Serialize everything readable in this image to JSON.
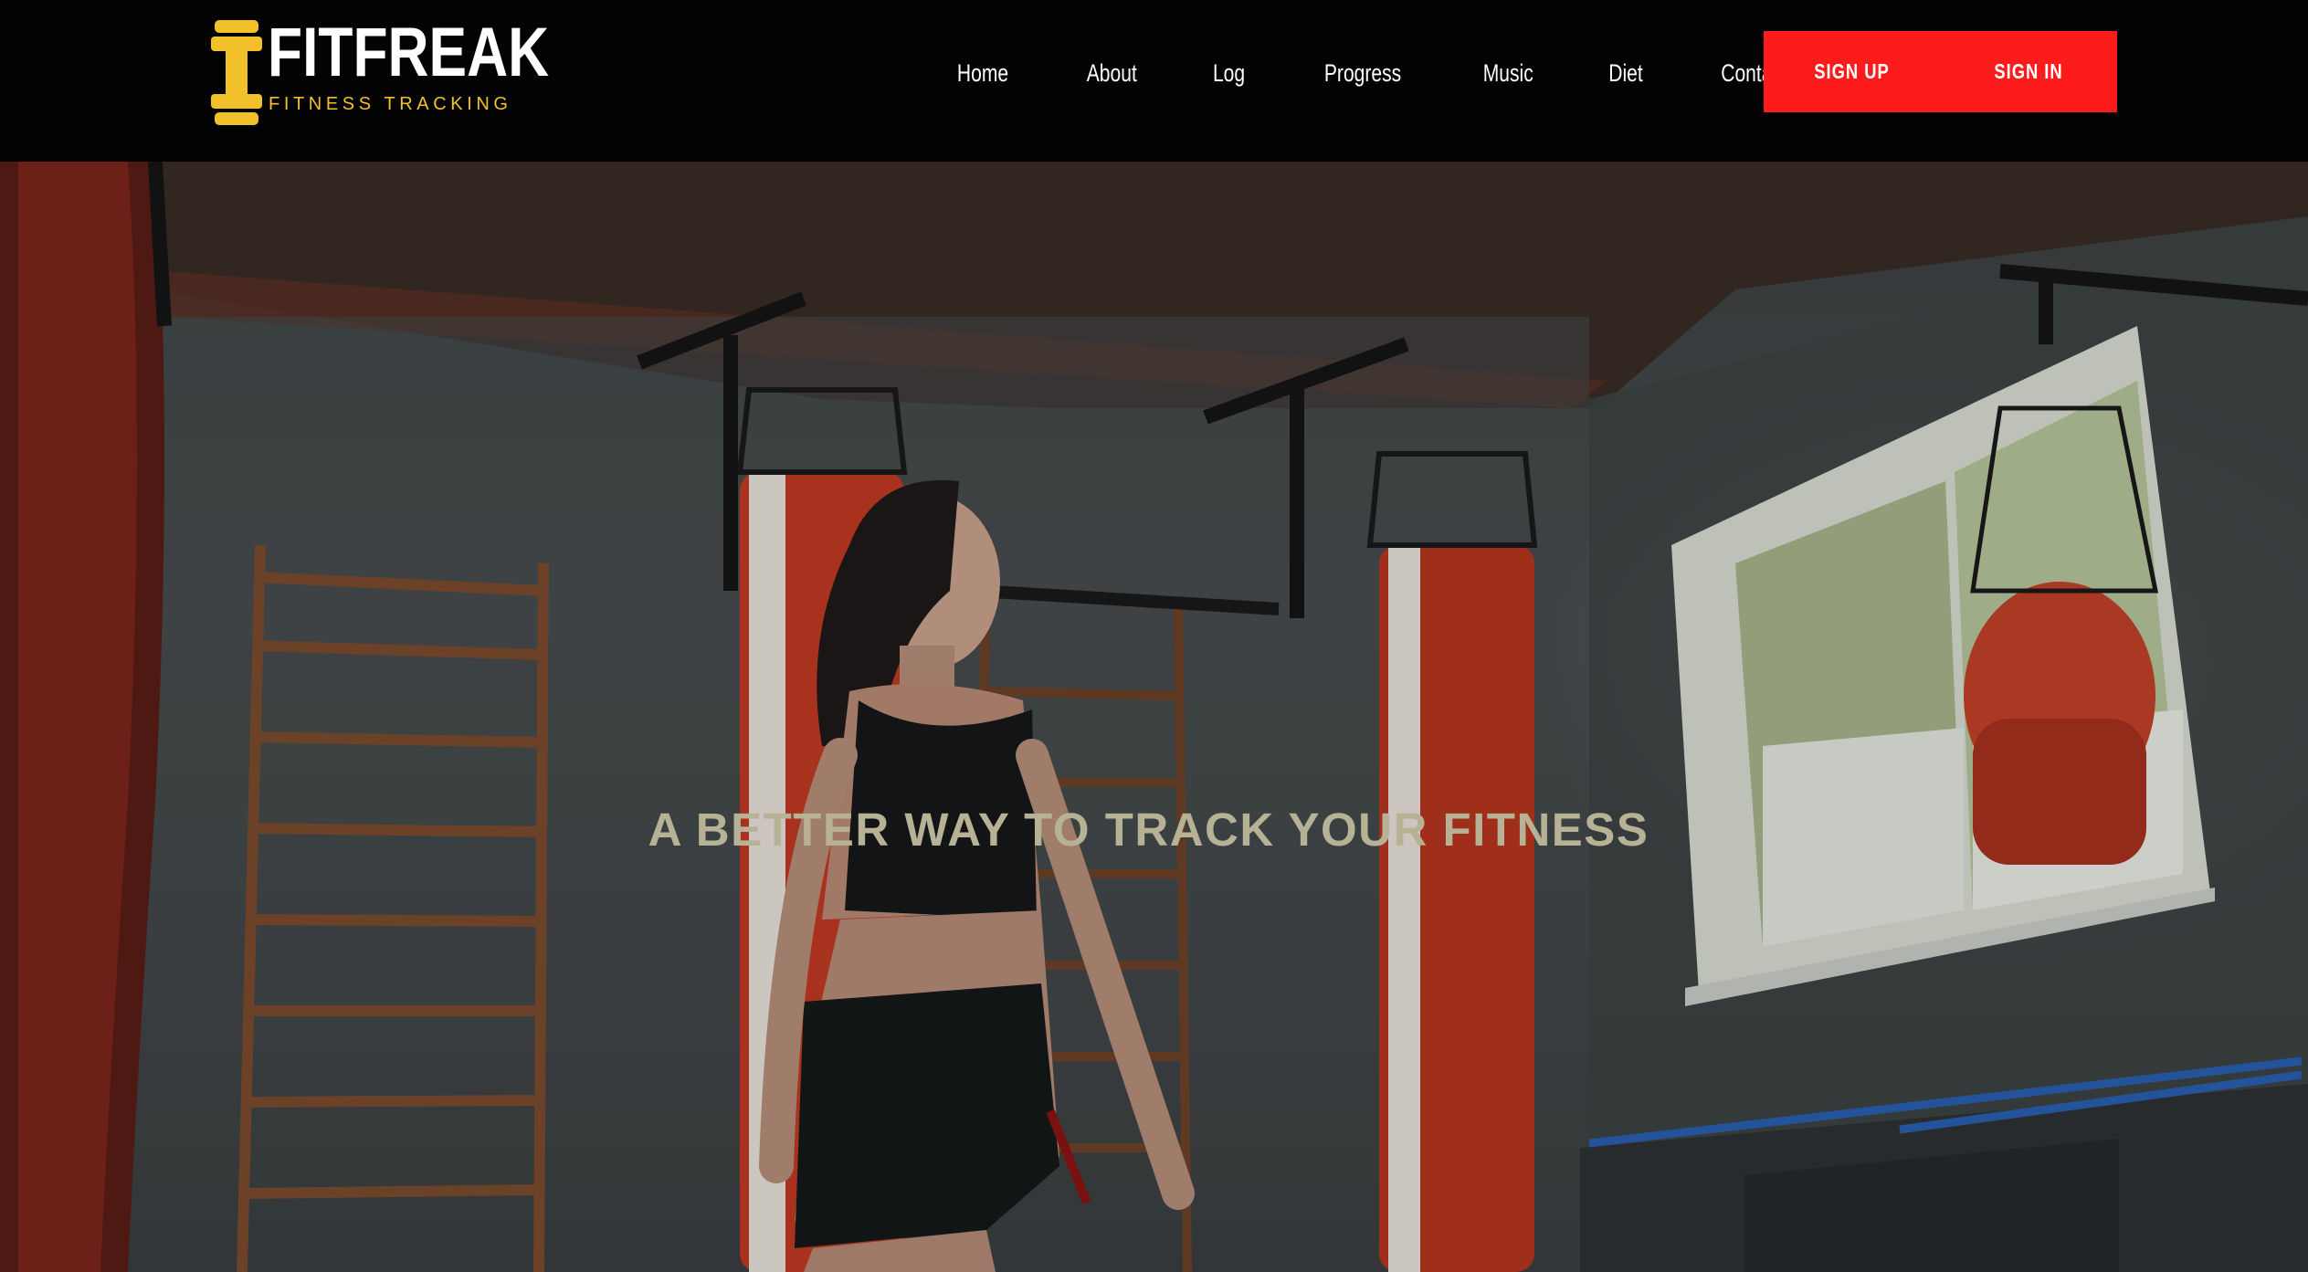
{
  "brand": {
    "title": "FITFREAK",
    "subtitle": "FITNESS TRACKING",
    "accent_color": "#f2c02a",
    "icon": "dumbbell-icon"
  },
  "nav": {
    "items": [
      {
        "label": "Home"
      },
      {
        "label": "About"
      },
      {
        "label": "Log"
      },
      {
        "label": "Progress"
      },
      {
        "label": "Music"
      },
      {
        "label": "Diet"
      },
      {
        "label": "Contact"
      }
    ]
  },
  "auth": {
    "sign_up": "SIGN UP",
    "sign_in": "SIGN IN",
    "color": "#fe1b1b"
  },
  "hero": {
    "headline": "A BETTER WAY TO TRACK YOUR FITNESS",
    "headline_color": "#b7b196"
  }
}
